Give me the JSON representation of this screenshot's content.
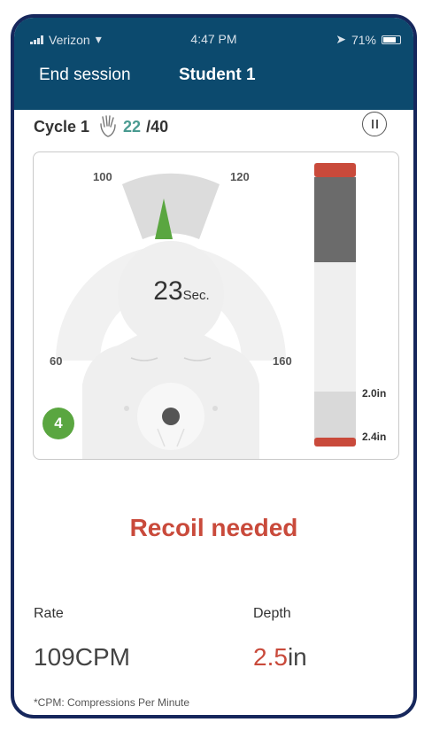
{
  "status_bar": {
    "carrier": "Verizon",
    "time": "4:47 PM",
    "battery": "71%"
  },
  "header": {
    "end_session": "End session",
    "title": "Student 1"
  },
  "cycle": {
    "label": "Cycle 1",
    "count": "22",
    "total": "/40"
  },
  "gauge": {
    "ticks": {
      "t60": "60",
      "t100": "100",
      "t120": "120",
      "t160": "160"
    },
    "timer_value": "23",
    "timer_unit": "Sec.",
    "badge": "4"
  },
  "depth_bar": {
    "upper_label": "2.0in",
    "lower_label": "2.4in"
  },
  "message": "Recoil needed",
  "rate": {
    "label": "Rate",
    "value": "109CPM"
  },
  "depth": {
    "label": "Depth",
    "value_number": "2.5",
    "value_unit": "in"
  },
  "footnote": "*CPM: Compressions Per Minute",
  "colors": {
    "navy": "#0c4a6e",
    "frame": "#16275c",
    "accent_green": "#5aa640",
    "teal": "#4a9b91",
    "alert_red": "#c94a3b"
  }
}
